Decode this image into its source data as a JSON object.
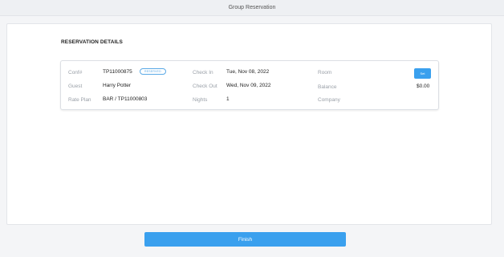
{
  "header": {
    "title": "Group Reservation"
  },
  "section": {
    "title": "RESERVATION DETAILS"
  },
  "reservation": {
    "conf_label": "Conf#",
    "conf_value": "TP11000875",
    "status_badge": "RESERVED",
    "guest_label": "Guest",
    "guest_value": "Harry Potter",
    "rate_plan_label": "Rate Plan",
    "rate_plan_value": "BAR / TP11000803",
    "check_in_label": "Check In",
    "check_in_value": "Tue, Nov 08, 2022",
    "check_out_label": "Check Out",
    "check_out_value": "Wed, Nov 09, 2022",
    "nights_label": "Nights",
    "nights_value": "1",
    "room_label": "Room",
    "room_button": "Set",
    "balance_label": "Balance",
    "balance_value": "$0.00",
    "company_label": "Company"
  },
  "footer": {
    "finish_label": "Finish"
  },
  "colors": {
    "accent": "#3aa0ee",
    "badge": "#5aa9e6"
  }
}
